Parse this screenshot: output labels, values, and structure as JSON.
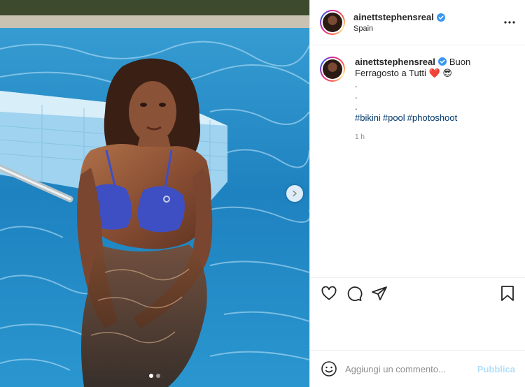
{
  "post": {
    "username": "ainettstephensreal",
    "location": "Spain",
    "caption": {
      "text": "Buon Ferragosto a Tutti",
      "emojis": [
        "❤️",
        "😎"
      ],
      "dots": [
        ".",
        ".",
        "."
      ],
      "hashtags": [
        "#bikini",
        "#pool",
        "#photoshoot"
      ]
    },
    "time_ago": "1 h"
  },
  "composer": {
    "placeholder": "Aggiungi un commento...",
    "publish_label": "Pubblica"
  },
  "media": {
    "slide_count": 2,
    "active_slide": 1
  },
  "colors": {
    "verified": "#3897f0",
    "link": "#00376b",
    "publish_disabled": "#b2dffc",
    "border": "#efefef"
  },
  "icons": {
    "like": "heart-icon",
    "comment": "comment-icon",
    "share": "share-icon",
    "save": "bookmark-icon",
    "more": "more-options-icon",
    "emoji": "emoji-icon",
    "next": "chevron-right-icon"
  }
}
